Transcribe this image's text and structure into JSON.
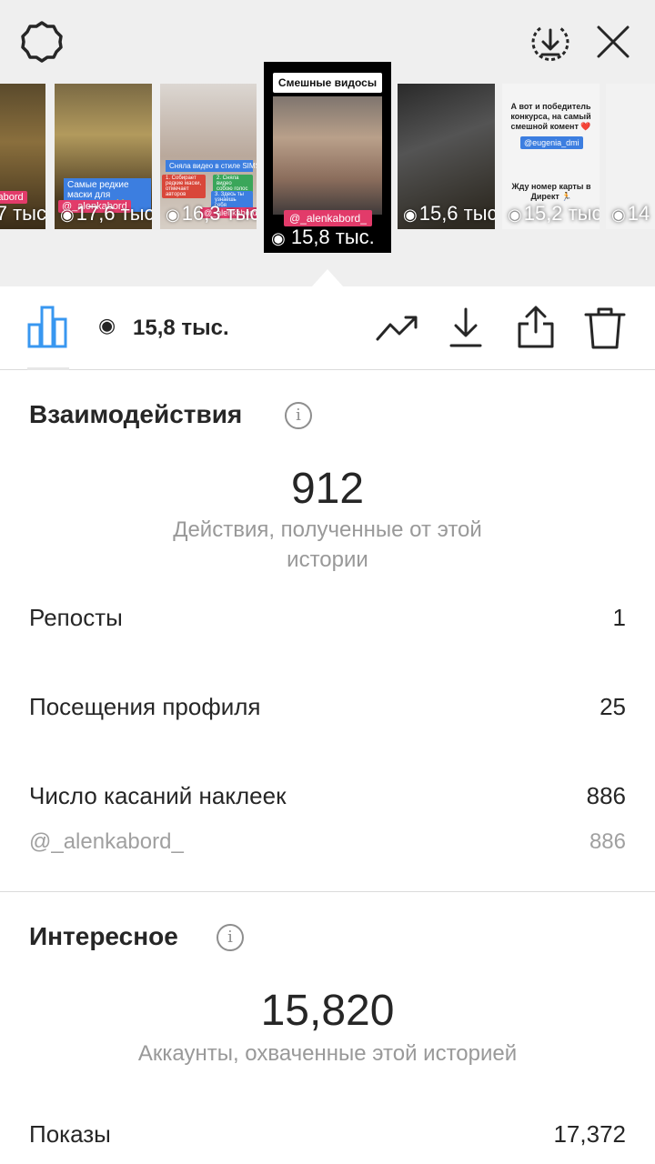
{
  "header": {
    "icons": [
      "gear-icon",
      "download-circle-icon",
      "close-icon"
    ]
  },
  "stories": [
    {
      "views": "7 тыс",
      "tag": "kabord"
    },
    {
      "views": "17,6 тыс",
      "caption": "Самые редкие маски для Инстаграм 🙀",
      "tag": "@_alenkabord"
    },
    {
      "views": "16,3 тыс",
      "caption": "Сняла видео в стиле SIMS",
      "notes": [
        "1. Собирает редкие маски, отмечает авторов",
        "2. Сняла видео собою голос",
        "3. Здесь ты узнаешь себя"
      ],
      "tag": "@_alenkabord_"
    },
    {
      "views": "15,6 тыс"
    },
    {
      "views": "15,2 тыс",
      "caption_top": "А вот и победитель конкурса, на самый смешной комент ❤️",
      "mention": "@eugenia_dmi",
      "caption_bottom": "Жду номер карты в Директ 🏃"
    },
    {
      "views": "14"
    }
  ],
  "selected_story": {
    "title": "Смешные видосы 😂",
    "username": "@_alenkabord_",
    "views": "15,8 тыс."
  },
  "toolbar": {
    "view_count": "15,8 тыс.",
    "icons": [
      "insights-bars-icon",
      "trend-icon",
      "download-icon",
      "share-icon",
      "trash-icon"
    ]
  },
  "interactions": {
    "title": "Взаимодействия",
    "total": "912",
    "caption": "Действия, полученные от этой истории",
    "rows": [
      {
        "label": "Репосты",
        "value": "1"
      },
      {
        "label": "Посещения профиля",
        "value": "25"
      },
      {
        "label": "Число касаний наклеек",
        "value": "886"
      }
    ],
    "sub_row": {
      "label": "@_alenkabord_",
      "value": "886"
    }
  },
  "discovery": {
    "title": "Интересное",
    "total": "15,820",
    "caption": "Аккаунты, охваченные этой историей",
    "rows": [
      {
        "label": "Показы",
        "value": "17,372"
      }
    ]
  },
  "colors": {
    "accent_blue": "#3897f0",
    "tag_pink": "#e23b6a",
    "top_bg": "#efefef"
  }
}
